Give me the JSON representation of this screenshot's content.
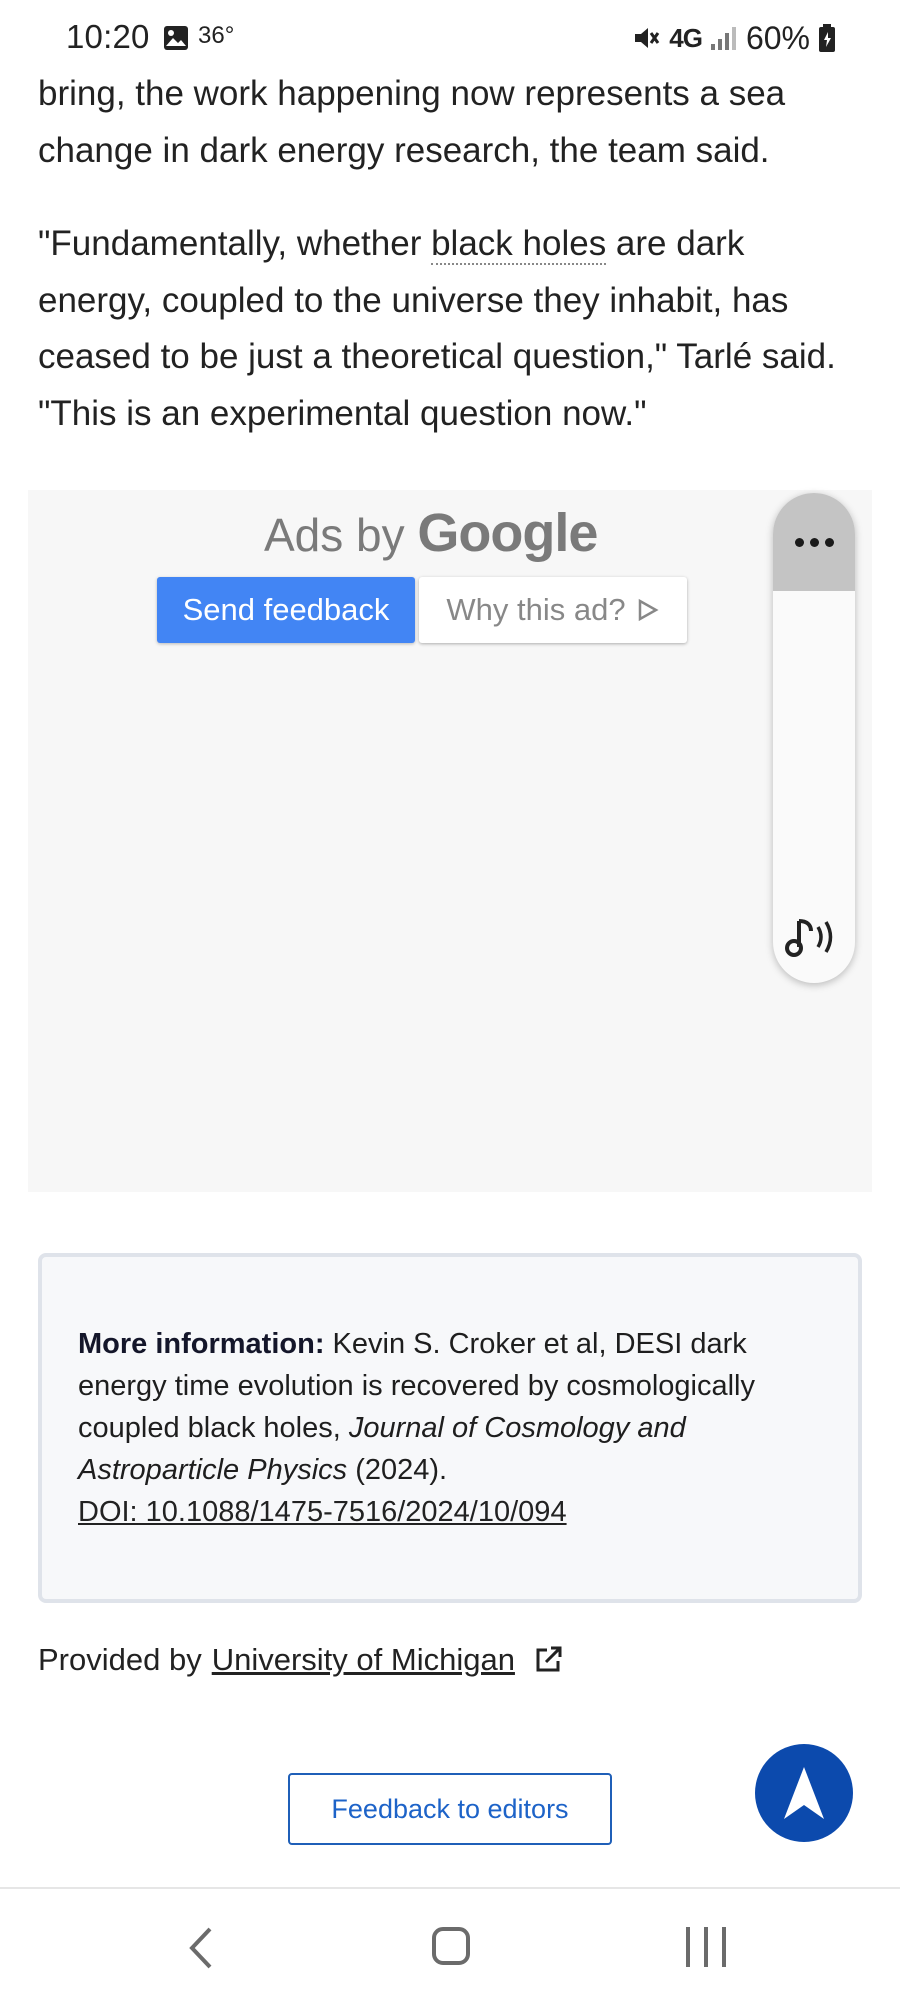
{
  "status_bar": {
    "time": "10:20",
    "temperature": "36°",
    "network": "4G",
    "battery": "60%",
    "icons": [
      "gallery-icon",
      "mute-icon",
      "signal-icon",
      "battery-icon"
    ]
  },
  "article": {
    "para1": "bring, the work happening now represents a sea change in dark energy research, the team said.",
    "para2_before": "\"Fundamentally, whether ",
    "para2_link": "black holes",
    "para2_after": " are dark energy, coupled to the universe they inhabit, has ceased to be just a theoretical question,\" Tarlé said. \"This is an experimental question now.\""
  },
  "ad": {
    "ads_by": "Ads by",
    "google": "Google",
    "send_feedback": "Send feedback",
    "why_this_ad": "Why this ad?"
  },
  "more_info": {
    "label": "More information:",
    "text_before": " Kevin S. Croker et al, DESI dark energy time evolution is recovered by cosmologically coupled black holes, ",
    "journal": "Journal of Cosmology and Astroparticle Physics",
    "year": " (2024).",
    "doi": "DOI: 10.1088/1475-7516/2024/10/094"
  },
  "provided": {
    "label": "Provided by",
    "source": "University of Michigan"
  },
  "feedback_button": "Feedback to editors",
  "colors": {
    "ad_feedback_bg": "#4285f4",
    "fab_bg": "#0c4aad",
    "feedback_border": "#1f5fb8"
  }
}
